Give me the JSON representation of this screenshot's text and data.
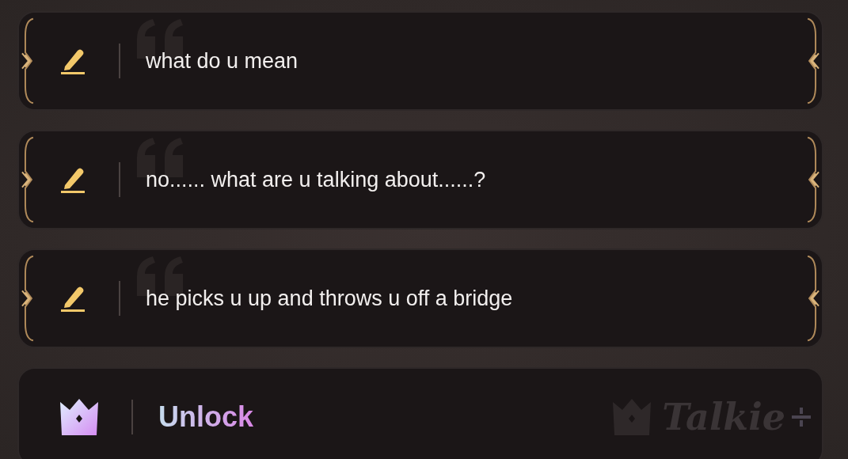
{
  "options": [
    {
      "text": "what do u mean"
    },
    {
      "text": "no...... what are u talking about......?"
    },
    {
      "text": "he picks u up and throws u off a bridge"
    }
  ],
  "unlock": {
    "label": "Unlock",
    "brand": "Talkie"
  }
}
